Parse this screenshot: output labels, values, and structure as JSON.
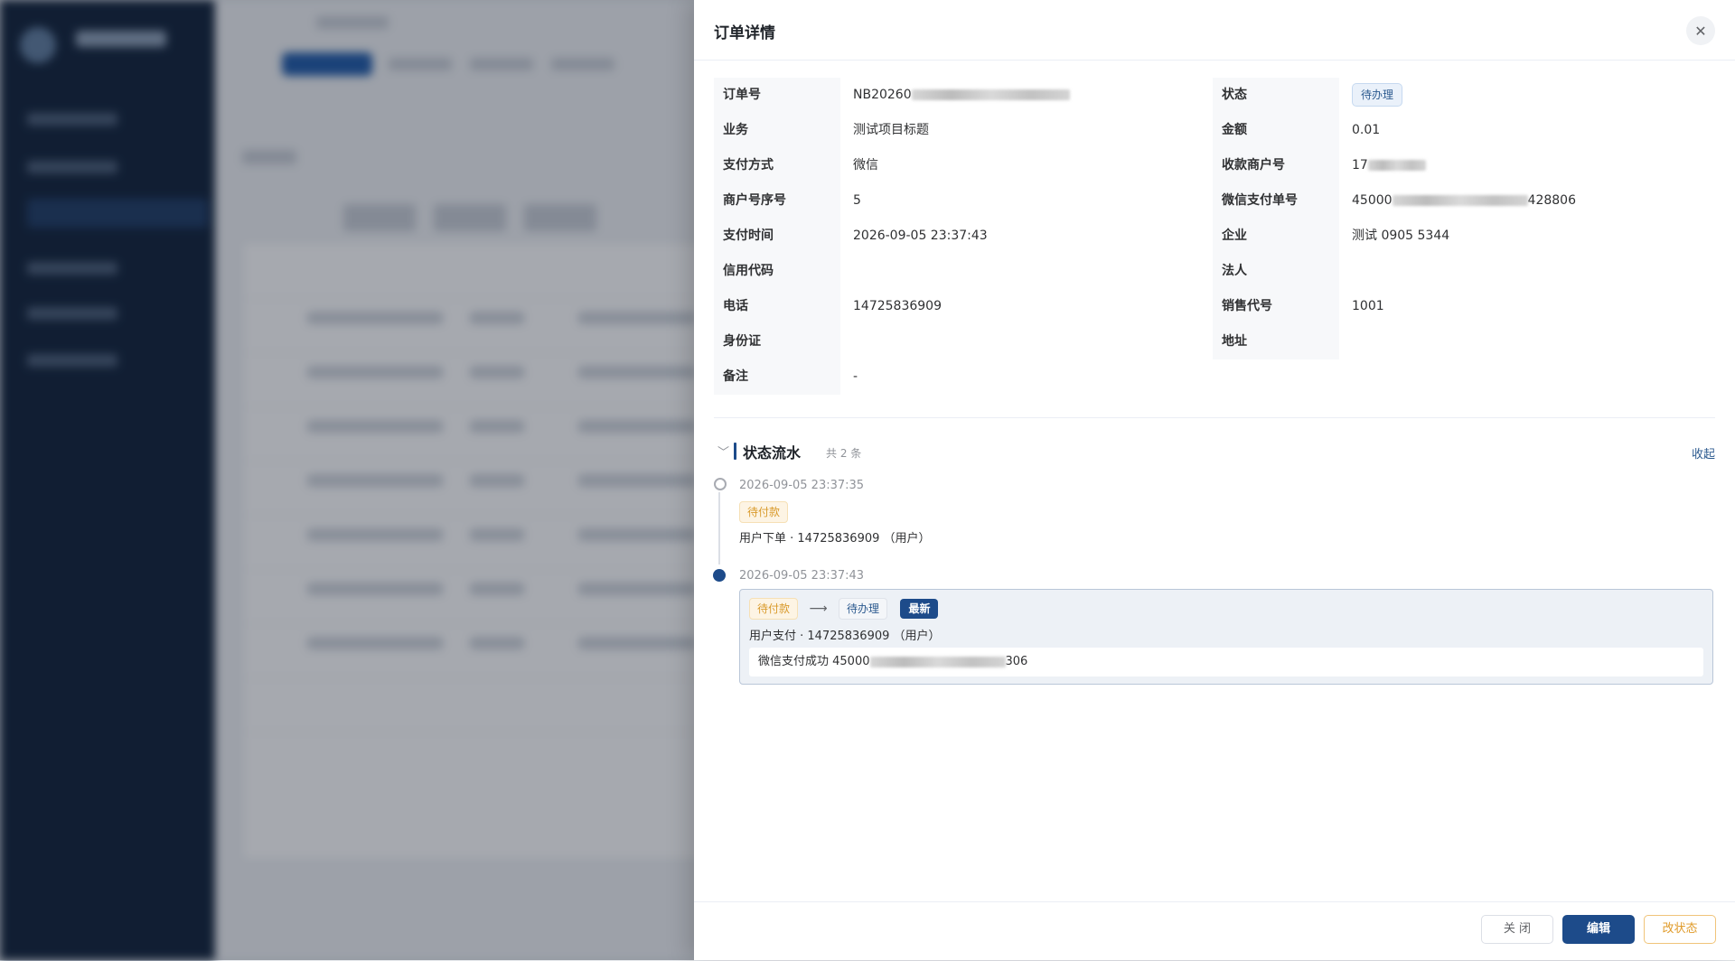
{
  "drawer": {
    "title": "订单详情",
    "close_icon": "close-icon"
  },
  "details": {
    "left": [
      {
        "label": "订单号",
        "value": "NB20260"
      },
      {
        "label": "业务",
        "value": "测试项目标题"
      },
      {
        "label": "支付方式",
        "value": "微信"
      },
      {
        "label": "商户号序号",
        "value": "5"
      },
      {
        "label": "支付时间",
        "value": "2026-09-05 23:37:43"
      },
      {
        "label": "信用代码",
        "value": ""
      },
      {
        "label": "电话",
        "value": "14725836909"
      },
      {
        "label": "身份证",
        "value": ""
      },
      {
        "label": "备注",
        "value": "-"
      }
    ],
    "right": [
      {
        "label": "状态",
        "value": "待办理"
      },
      {
        "label": "金额",
        "value": "0.01"
      },
      {
        "label": "收款商户号",
        "value": "17"
      },
      {
        "label": "微信支付单号",
        "value_prefix": "45000",
        "value_suffix": "428806"
      },
      {
        "label": "企业",
        "value": "测试 0905 5344"
      },
      {
        "label": "法人",
        "value": ""
      },
      {
        "label": "销售代号",
        "value": "1001"
      },
      {
        "label": "地址",
        "value": ""
      }
    ]
  },
  "flow": {
    "title": "状态流水",
    "count": "共 2 条",
    "collapse_label": "收起",
    "events": [
      {
        "time": "2026-09-05 23:37:35",
        "status": "待付款",
        "desc": "用户下单 · 14725836909 （用户）"
      },
      {
        "time": "2026-09-05 23:37:43",
        "from_status": "待付款",
        "to_status": "待办理",
        "latest_badge": "最新",
        "desc": "用户支付 · 14725836909 （用户）",
        "note_prefix": "微信支付成功 45000",
        "note_suffix": "306"
      }
    ]
  },
  "footer": {
    "close_label": "关 闭",
    "edit_label": "编辑",
    "change_status_label": "改状态"
  },
  "colors": {
    "primary": "#1d4b8a",
    "pending_orange": "#d99a2b",
    "sidebar_bg": "#0f2038"
  }
}
